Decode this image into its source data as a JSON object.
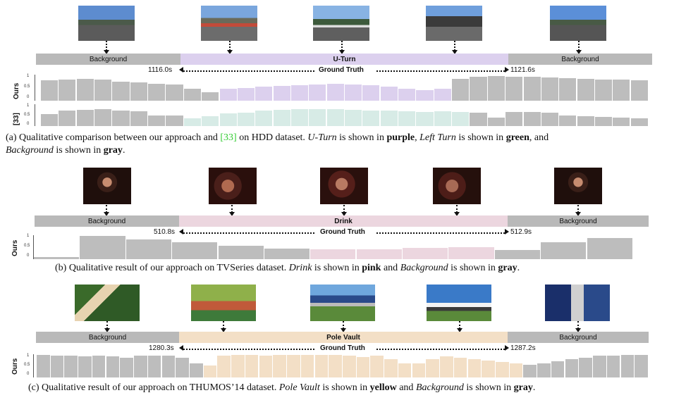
{
  "colors": {
    "gray": "#b9b9b9",
    "purple": "#dcd0ee",
    "green": "#d7ebe6",
    "pink": "#ecd6df",
    "yellow": "#f3dfc6",
    "bar_gray": "#bdbdbd"
  },
  "panels": [
    {
      "id": "a",
      "segments": [
        {
          "label": "Background",
          "color": "gray",
          "bold": false
        },
        {
          "label": "U-Turn",
          "color": "purple",
          "bold": true
        },
        {
          "label": "Background",
          "color": "gray",
          "bold": false
        }
      ],
      "gt": {
        "left": "1116.0s",
        "mid": "Ground Truth",
        "right": "1121.6s"
      },
      "rows": [
        {
          "label": "Ours",
          "ticks": [
            "1",
            "0.5",
            "0"
          ],
          "values": [
            0.78,
            0.81,
            0.84,
            0.82,
            0.73,
            0.71,
            0.65,
            0.63,
            0.47,
            0.33,
            0.47,
            0.49,
            0.55,
            0.58,
            0.6,
            0.62,
            0.64,
            0.62,
            0.59,
            0.54,
            0.46,
            0.4,
            0.46,
            0.84,
            0.92,
            0.95,
            0.93,
            0.91,
            0.9,
            0.86,
            0.84,
            0.82,
            0.8,
            0.78
          ],
          "colors": [
            "gray",
            "gray",
            "gray",
            "gray",
            "gray",
            "gray",
            "gray",
            "gray",
            "gray",
            "gray",
            "purple",
            "purple",
            "purple",
            "purple",
            "purple",
            "purple",
            "purple",
            "purple",
            "purple",
            "purple",
            "purple",
            "purple",
            "purple",
            "gray",
            "gray",
            "gray",
            "gray",
            "gray",
            "gray",
            "gray",
            "gray",
            "gray",
            "gray",
            "gray"
          ]
        },
        {
          "label": "[33]",
          "ticks": [
            "1",
            "0.5",
            "0"
          ],
          "values": [
            0.56,
            0.7,
            0.74,
            0.76,
            0.72,
            0.68,
            0.5,
            0.48,
            0.35,
            0.45,
            0.58,
            0.62,
            0.7,
            0.74,
            0.76,
            0.78,
            0.77,
            0.74,
            0.72,
            0.7,
            0.69,
            0.66,
            0.68,
            0.66,
            0.6,
            0.4,
            0.66,
            0.65,
            0.6,
            0.5,
            0.45,
            0.42,
            0.38,
            0.34
          ],
          "colors": [
            "gray",
            "gray",
            "gray",
            "gray",
            "gray",
            "gray",
            "gray",
            "gray",
            "green",
            "green",
            "green",
            "green",
            "green",
            "green",
            "green",
            "green",
            "green",
            "green",
            "green",
            "green",
            "green",
            "green",
            "green",
            "green",
            "gray",
            "gray",
            "gray",
            "gray",
            "gray",
            "gray",
            "gray",
            "gray",
            "gray",
            "gray"
          ]
        }
      ]
    },
    {
      "id": "b",
      "segments": [
        {
          "label": "Background",
          "color": "gray",
          "bold": false
        },
        {
          "label": "Drink",
          "color": "pink",
          "bold": true
        },
        {
          "label": "Background",
          "color": "gray",
          "bold": false
        }
      ],
      "gt": {
        "left": "510.8s",
        "mid": "Ground Truth",
        "right": "512.9s"
      },
      "rows": [
        {
          "label": "Ours",
          "ticks": [
            "1",
            "0.5",
            "0"
          ],
          "values": [
            0.1,
            0.97,
            0.82,
            0.7,
            0.55,
            0.45,
            0.4,
            0.4,
            0.48,
            0.5,
            0.38,
            0.72,
            0.88
          ],
          "colors": [
            "gray",
            "gray",
            "gray",
            "gray",
            "gray",
            "gray",
            "pink",
            "pink",
            "pink",
            "pink",
            "gray",
            "gray",
            "gray"
          ]
        }
      ]
    },
    {
      "id": "c",
      "segments": [
        {
          "label": "Background",
          "color": "gray",
          "bold": false
        },
        {
          "label": "Pole Vault",
          "color": "yellow",
          "bold": true
        },
        {
          "label": "Background",
          "color": "gray",
          "bold": false
        }
      ],
      "gt": {
        "left": "1280.3s",
        "mid": "Ground Truth",
        "right": "1287.2s"
      },
      "rows": [
        {
          "label": "Ours",
          "ticks": [
            "1",
            "0.5",
            "0"
          ],
          "values": [
            0.97,
            0.95,
            0.93,
            0.92,
            0.94,
            0.9,
            0.85,
            0.93,
            0.95,
            0.94,
            0.86,
            0.6,
            0.52,
            0.95,
            0.98,
            0.97,
            0.93,
            0.96,
            0.97,
            0.98,
            0.97,
            0.96,
            0.94,
            0.88,
            0.93,
            0.8,
            0.62,
            0.62,
            0.8,
            0.92,
            0.86,
            0.78,
            0.72,
            0.66,
            0.62,
            0.55,
            0.6,
            0.7,
            0.78,
            0.86,
            0.93,
            0.95,
            0.98,
            0.98
          ],
          "colors": [
            "gray",
            "gray",
            "gray",
            "gray",
            "gray",
            "gray",
            "gray",
            "gray",
            "gray",
            "gray",
            "gray",
            "gray",
            "yellow",
            "yellow",
            "yellow",
            "yellow",
            "yellow",
            "yellow",
            "yellow",
            "yellow",
            "yellow",
            "yellow",
            "yellow",
            "yellow",
            "yellow",
            "yellow",
            "yellow",
            "yellow",
            "yellow",
            "yellow",
            "yellow",
            "yellow",
            "yellow",
            "yellow",
            "yellow",
            "gray",
            "gray",
            "gray",
            "gray",
            "gray",
            "gray",
            "gray",
            "gray",
            "gray"
          ]
        }
      ]
    }
  ],
  "captions": {
    "a": {
      "p1": "(a) Qualitative comparison between our approach and ",
      "ref": "[33]",
      "p2": " on HDD dataset. ",
      "em1": "U-Turn",
      "p3": " is shown in ",
      "b1": "purple",
      "p4": ", ",
      "em2": "Left Turn",
      "p5": " is shown in ",
      "b2": "green",
      "p6": ", and",
      "em3": "Background",
      "p7": " is shown in ",
      "b3": "gray",
      "p8": "."
    },
    "b": {
      "p1": "(b) Qualitative result of our approach on TVSeries dataset. ",
      "em1": "Drink",
      "p2": " is shown in ",
      "b1": "pink",
      "p3": " and ",
      "em2": "Background",
      "p4": " is shown in ",
      "b2": "gray",
      "p5": "."
    },
    "c": {
      "p1": "(c) Qualitative result of our approach on THUMOS’14 dataset. ",
      "em1": "Pole Vault",
      "p2": " is shown in ",
      "b1": "yellow",
      "p3": " and ",
      "em2": "Background",
      "p4": " is shown in ",
      "b2": "gray",
      "p5": "."
    }
  }
}
